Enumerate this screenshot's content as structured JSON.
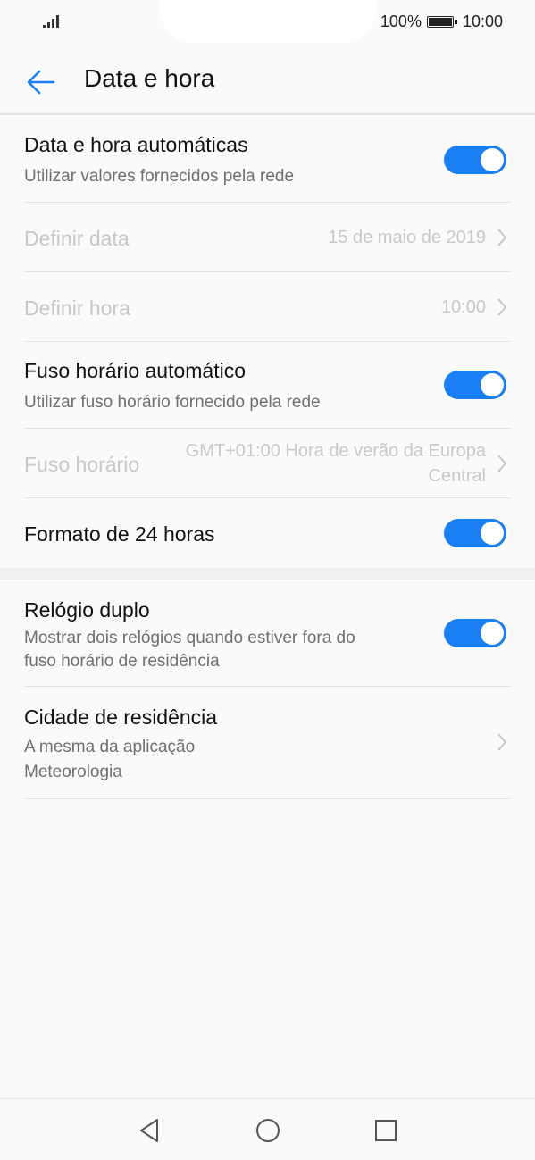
{
  "status_bar": {
    "battery": "100%",
    "time": "10:00",
    "icons": [
      "signal-icon",
      "battery-icon"
    ]
  },
  "header": {
    "title": "Data e hora",
    "back_icon": "back-arrow-icon"
  },
  "settings": {
    "auto_datetime": {
      "label": "Data e hora automáticas",
      "sub": "Utilizar valores fornecidos pela rede",
      "enabled": true
    },
    "set_date": {
      "label": "Definir data",
      "value": "15 de maio de 2019"
    },
    "set_time": {
      "label": "Definir hora",
      "value": "10:00"
    },
    "auto_timezone": {
      "label": "Fuso horário automático",
      "sub": "Utilizar fuso horário fornecido pela rede",
      "enabled": true
    },
    "timezone": {
      "label": "Fuso horário",
      "value_line1": "GMT+01:00 Hora de verão da Europa",
      "value_line2": "Central"
    },
    "format_24h": {
      "label": "Formato de 24 horas",
      "enabled": true
    },
    "dual_clock": {
      "label": "Relógio duplo",
      "sub_line1": "Mostrar dois relógios quando estiver fora do",
      "sub_line2": "fuso horário de residência",
      "enabled": true
    },
    "home_city": {
      "label": "Cidade de residência",
      "sub_line1": "A mesma da aplicação",
      "sub_line2": "Meteorologia"
    }
  },
  "nav_bar": {
    "icons": [
      "back-triangle-icon",
      "home-circle-icon",
      "recents-square-icon"
    ]
  },
  "colors": {
    "accent": "#1a7ef5",
    "background": "#fafafa",
    "disabled_text": "#c8c8c8"
  }
}
